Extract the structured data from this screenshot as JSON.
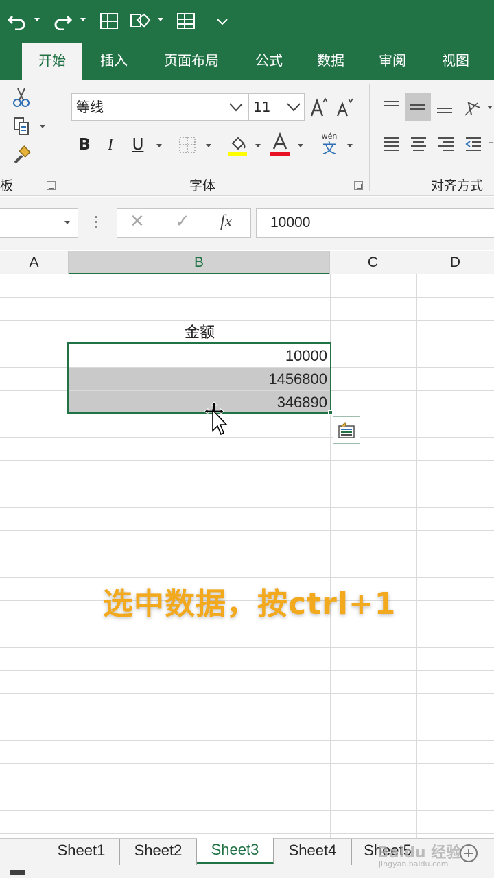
{
  "qat": {
    "icons": [
      "undo-icon",
      "redo-icon",
      "table-icon",
      "shape-icon",
      "grid-icon",
      "customize-icon"
    ]
  },
  "ribbon": {
    "tabs": [
      {
        "label": "开始",
        "active": true
      },
      {
        "label": "插入"
      },
      {
        "label": "页面布局"
      },
      {
        "label": "公式"
      },
      {
        "label": "数据"
      },
      {
        "label": "审阅"
      },
      {
        "label": "视图"
      }
    ],
    "clipboard_group": "板",
    "font_group": "字体",
    "alignment_group": "对齐方式",
    "font_name": "等线",
    "font_size": "11",
    "bold": "B",
    "italic": "I",
    "underline": "U",
    "phonetic_top": "wén",
    "phonetic_bottom": "文"
  },
  "formula_bar": {
    "cancel": "✕",
    "enter": "✓",
    "fx": "fx",
    "value": "10000"
  },
  "grid": {
    "columns": [
      "A",
      "B",
      "C",
      "D"
    ],
    "selected_column": "B",
    "header_cell": "金额",
    "values": [
      "10000",
      "1456800",
      "346890"
    ]
  },
  "caption": "选中数据，按ctrl+1",
  "sheets": [
    "Sheet1",
    "Sheet2",
    "Sheet3",
    "Sheet4",
    "Sheet5"
  ],
  "active_sheet": "Sheet3",
  "watermark": "Baidu 经验",
  "watermark_url": "jingyan.baidu.com",
  "colors": {
    "brand": "#217346",
    "selection_fill": "#c9c9c9",
    "caption": "#f2a91e"
  }
}
